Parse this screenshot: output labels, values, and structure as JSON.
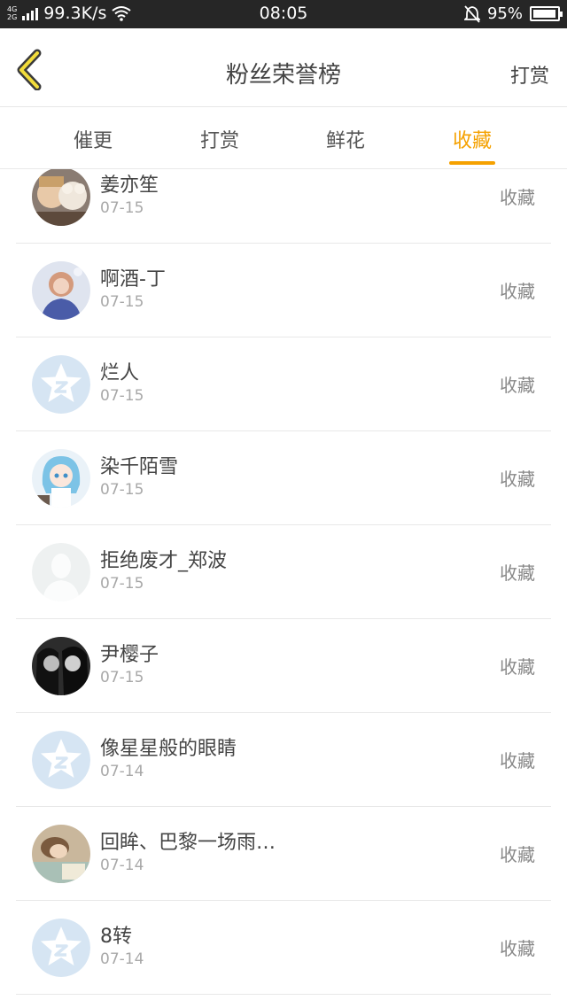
{
  "status_bar": {
    "network_top": "4G",
    "network_bottom": "2G",
    "speed": "99.3K/s",
    "time": "08:05",
    "battery": "95%",
    "battery_level": 0.95
  },
  "header": {
    "title": "粉丝荣誉榜",
    "right_action": "打赏"
  },
  "tabs": [
    {
      "label": "催更",
      "active": false
    },
    {
      "label": "打赏",
      "active": false
    },
    {
      "label": "鲜花",
      "active": false
    },
    {
      "label": "收藏",
      "active": true
    }
  ],
  "colors": {
    "accent": "#f5a100",
    "text": "#444444",
    "muted": "#a8a8a8",
    "default_avatar": "#d6e5f3"
  },
  "rows": [
    {
      "name": "姜亦笙",
      "date": "07-15",
      "action": "收藏",
      "avatar": "photo-child-bear"
    },
    {
      "name": "啊酒-丁",
      "date": "07-15",
      "action": "收藏",
      "avatar": "photo-girl-blue"
    },
    {
      "name": "烂人",
      "date": "07-15",
      "action": "收藏",
      "avatar": "default-star-avatar"
    },
    {
      "name": "染千陌雪",
      "date": "07-15",
      "action": "收藏",
      "avatar": "anime-girl"
    },
    {
      "name": "拒绝废才_郑波",
      "date": "07-15",
      "action": "收藏",
      "avatar": "silhouette-avatar"
    },
    {
      "name": "尹樱子",
      "date": "07-15",
      "action": "收藏",
      "avatar": "photo-bw-couple"
    },
    {
      "name": "像星星般的眼睛",
      "date": "07-14",
      "action": "收藏",
      "avatar": "default-star-avatar"
    },
    {
      "name": "回眸、巴黎一场雨…",
      "date": "07-14",
      "action": "收藏",
      "avatar": "photo-sleeping"
    },
    {
      "name": "8转",
      "date": "07-14",
      "action": "收藏",
      "avatar": "default-star-avatar"
    }
  ]
}
